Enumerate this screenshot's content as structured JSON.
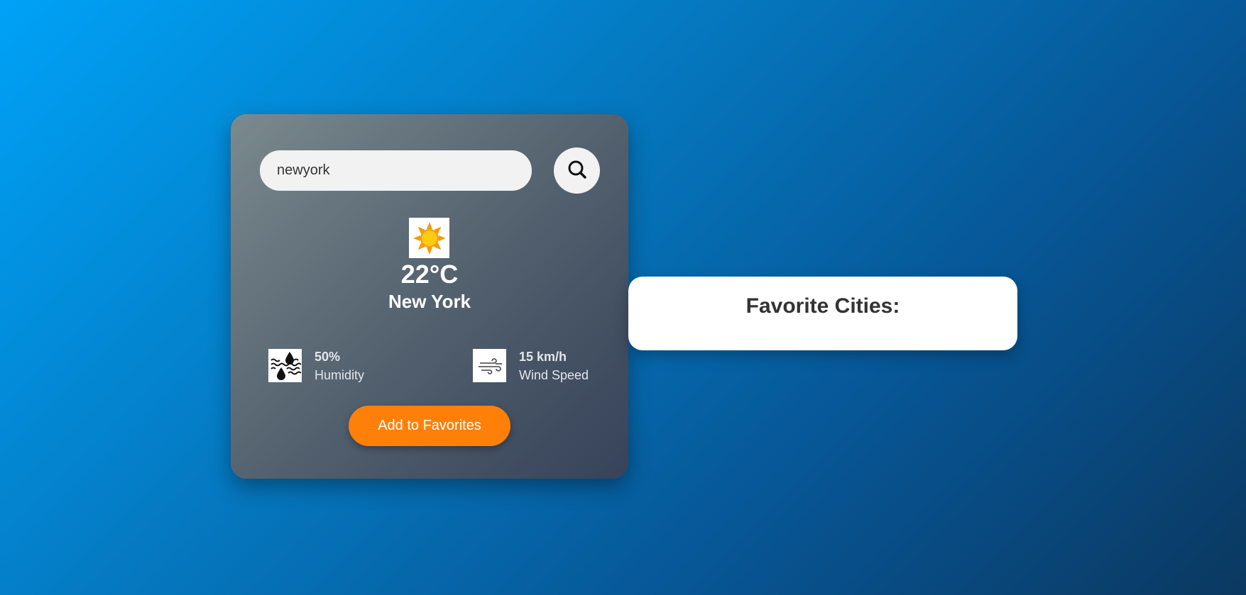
{
  "search": {
    "value": "newyork",
    "button_icon": "search-icon"
  },
  "weather": {
    "icon": "sun-icon",
    "temperature": "22°C",
    "city": "New York",
    "humidity": {
      "icon": "humidity-icon",
      "value": "50%",
      "label": "Humidity"
    },
    "wind": {
      "icon": "wind-icon",
      "value": "15 km/h",
      "label": "Wind Speed"
    },
    "add_favorite_label": "Add to Favorites"
  },
  "favorites": {
    "title": "Favorite Cities:",
    "items": []
  },
  "colors": {
    "accent": "#ff8008",
    "card_start": "#7b8a8e",
    "card_end": "#36435a",
    "background_start": "#00a2f7",
    "background_end": "#0b3860"
  }
}
